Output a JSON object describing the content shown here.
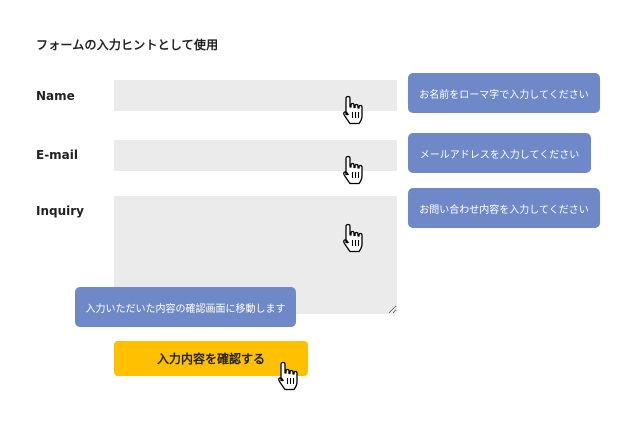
{
  "page": {
    "title": "フォームの入力ヒントとして使用"
  },
  "form": {
    "name_label": "Name",
    "email_label": "E-mail",
    "inquiry_label": "Inquiry",
    "name_value": "",
    "email_value": "",
    "inquiry_value": "",
    "submit_label": "入力内容を確認する"
  },
  "tooltips": {
    "name": "お名前をローマ字で入力してください",
    "email": "メールアドレスを入力してください",
    "inquiry": "お問い合わせ内容を入力してください",
    "submit": "入力いただいた内容の確認画面に移動します"
  },
  "colors": {
    "tooltip_bg": "#6f88c7",
    "button_bg": "#ffc000",
    "field_bg": "#ebebeb"
  },
  "icons": {
    "cursor": "hand-pointer-icon"
  }
}
